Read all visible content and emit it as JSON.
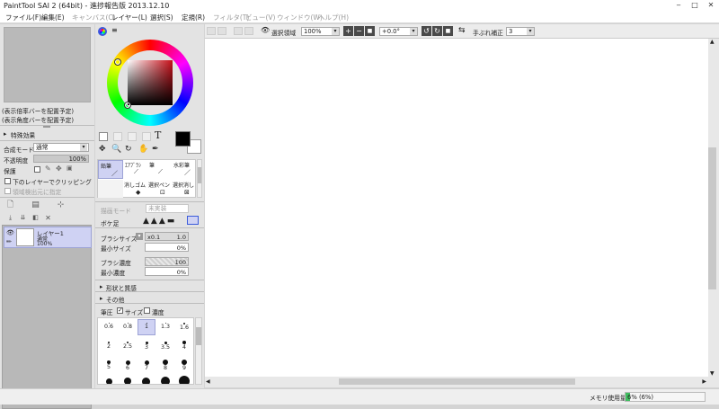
{
  "window": {
    "title": "PaintTool SAI 2 (64bit) - 進捗報告版 2013.12.10",
    "minimize": "‒",
    "maximize": "□",
    "close": "✕"
  },
  "menubar": [
    "ファイル(F)",
    "編集(E)",
    "キャンバス(C)",
    "レイヤー(L)",
    "選択(S)",
    "定規(R)",
    "フィルタ(T)",
    "ビュー(V)",
    "ウィンドウ(W)",
    "ヘルプ(H)"
  ],
  "menubar_disabled": [
    false,
    false,
    true,
    false,
    false,
    false,
    true,
    true,
    true,
    true
  ],
  "navigator": {
    "zoom_note": "(表示倍率バーを配置予定)",
    "angle_note": "(表示角度バーを配置予定)"
  },
  "layer_props": {
    "effects_label": "特殊効果",
    "blend_mode_label": "合成モード",
    "blend_mode_value": "通常",
    "opacity_label": "不透明度",
    "opacity_value": "100%",
    "protect_label": "保護",
    "clip_label": "下のレイヤーでクリッピング",
    "selection_source_label": "領域検出元に指定"
  },
  "layers": [
    {
      "name": "レイヤー1",
      "mode": "通常",
      "opacity": "100%"
    }
  ],
  "colors": {
    "accent": "#3b5bdb",
    "hue_field": "#c8101a",
    "foreground": "#000000",
    "background": "#ffffff",
    "layer_selected": "#cfd2f3"
  },
  "tools": {
    "text_icon": "T",
    "tabs": [
      "鉛筆",
      "ｴｱﾌﾞﾗｼ",
      "筆",
      "水彩筆",
      "消しゴム",
      "選択ペン",
      "選択消し"
    ],
    "blend_mode_label": "描画モード",
    "blend_mode_value": "未実装",
    "blur_label": "ボケ足",
    "brush_size_label": "ブラシサイズ",
    "brush_size_multiplier": "x0.1",
    "brush_size_value": "1.0",
    "min_size_label": "最小サイズ",
    "min_size_value": "0%",
    "density_label": "ブラシ濃度",
    "density_value": "100",
    "min_density_label": "最小濃度",
    "min_density_value": "0%",
    "shape_label": "形状と質感",
    "other_label": "その他",
    "pressure_label": "筆圧",
    "pressure_size_label": "サイズ",
    "pressure_density_label": "濃度",
    "size_presets": [
      "0.6",
      "0.8",
      "1",
      "1.3",
      "1.6",
      "2",
      "2.5",
      "3",
      "3.5",
      "4",
      "5",
      "6",
      "7",
      "8",
      "9"
    ]
  },
  "canvas_toolbar": {
    "selection_label": "選択領域",
    "zoom_value": "100%",
    "rotation_value": "+0.0°",
    "stabilizer_label": "手ぶれ補正",
    "stabilizer_value": "3"
  },
  "status": {
    "memory_label": "メモリ使用量",
    "memory_value": "6% (6%)",
    "memory_fraction": 0.06
  }
}
